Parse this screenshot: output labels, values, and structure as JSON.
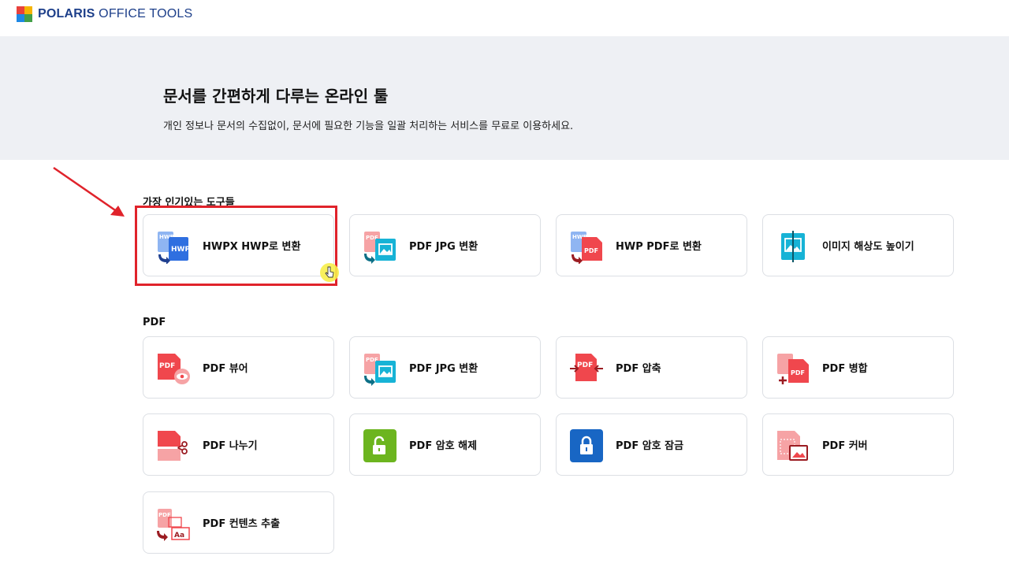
{
  "brand": {
    "name_bold": "POLARIS",
    "name_rest": " OFFICE TOOLS"
  },
  "hero": {
    "title": "문서를 간편하게 다루는 온라인 툴",
    "subtitle": "개인 정보나 문서의 수집없이, 문서에 필요한 기능을 일괄 처리하는 서비스를 무료로 이용하세요."
  },
  "popular": {
    "heading": "가장 인기있는 도구들",
    "items": [
      {
        "label": "HWPX HWP로 변환",
        "icon": "hwpx-to-hwp-icon"
      },
      {
        "label": "PDF JPG 변환",
        "icon": "pdf-to-jpg-icon"
      },
      {
        "label": "HWP PDF로 변환",
        "icon": "hwp-to-pdf-icon"
      },
      {
        "label": "이미지 해상도 높이기",
        "icon": "image-upscale-icon"
      }
    ]
  },
  "pdf": {
    "heading": "PDF",
    "items": [
      {
        "label": "PDF 뷰어",
        "icon": "pdf-viewer-icon"
      },
      {
        "label": "PDF JPG 변환",
        "icon": "pdf-to-jpg-icon"
      },
      {
        "label": "PDF 압축",
        "icon": "pdf-compress-icon"
      },
      {
        "label": "PDF 병합",
        "icon": "pdf-merge-icon"
      },
      {
        "label": "PDF 나누기",
        "icon": "pdf-split-icon"
      },
      {
        "label": "PDF 암호 해제",
        "icon": "pdf-unlock-icon"
      },
      {
        "label": "PDF 암호 잠금",
        "icon": "pdf-lock-icon"
      },
      {
        "label": "PDF 커버",
        "icon": "pdf-cover-icon"
      },
      {
        "label": "PDF 컨텐츠 추출",
        "icon": "pdf-extract-icon"
      }
    ]
  },
  "colors": {
    "highlight": "#e0232b",
    "hero_bg": "#eef0f4",
    "pdf_red": "#f0474d",
    "hwp_blue": "#2f6fe0",
    "image_cyan": "#17b3d6",
    "unlock_green": "#6cb51f",
    "lock_blue": "#1866c4"
  }
}
